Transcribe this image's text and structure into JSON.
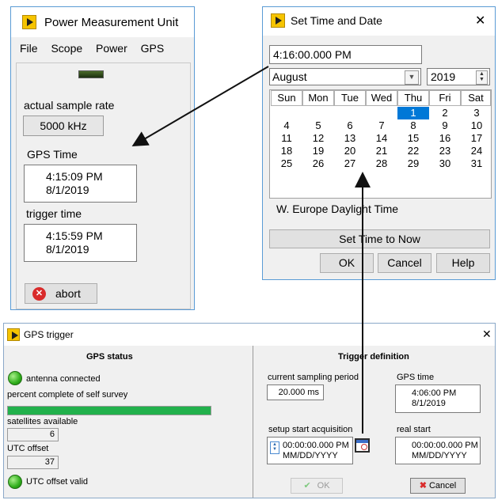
{
  "pmu": {
    "title": "Power Measurement Unit",
    "menu": [
      "File",
      "Scope",
      "Power",
      "GPS"
    ],
    "actual_sample_rate_label": "actual sample rate",
    "actual_sample_rate_value": "5000 kHz",
    "gps_time_label": "GPS Time",
    "gps_time_value": "4:15:09 PM",
    "gps_date_value": "8/1/2019",
    "trigger_time_label": "trigger time",
    "trigger_time_value": "4:15:59 PM",
    "trigger_date_value": "8/1/2019",
    "abort_label": "abort"
  },
  "set_time": {
    "title": "Set Time and Date",
    "close_glyph": "✕",
    "time_input_value": "4:16:00.000 PM",
    "month_value": "August",
    "year_value": "2019",
    "weekdays": [
      "Sun",
      "Mon",
      "Tue",
      "Wed",
      "Thu",
      "Fri",
      "Sat"
    ],
    "days": [
      "",
      "",
      "",
      "",
      "1",
      "2",
      "3",
      "4",
      "5",
      "6",
      "7",
      "8",
      "9",
      "10",
      "11",
      "12",
      "13",
      "14",
      "15",
      "16",
      "17",
      "18",
      "19",
      "20",
      "21",
      "22",
      "23",
      "24",
      "25",
      "26",
      "27",
      "28",
      "29",
      "30",
      "31"
    ],
    "selected_day": "1",
    "timezone": "W. Europe Daylight Time",
    "set_time_to_now_label": "Set Time to Now",
    "ok_label": "OK",
    "cancel_label": "Cancel",
    "help_label": "Help"
  },
  "gps_trigger": {
    "title": "GPS trigger",
    "close_glyph": "✕",
    "gps_status_heading": "GPS status",
    "antenna_connected_label": "antenna connected",
    "survey_label": "percent complete of self survey",
    "survey_progress": 1.0,
    "satellites_label": "satellites available",
    "satellites_value": "6",
    "utc_offset_label": "UTC offset",
    "utc_offset_value": "37",
    "utc_offset_valid_label": "UTC offset valid",
    "trigger_definition_heading": "Trigger definition",
    "current_sampling_period_label": "current sampling period",
    "current_sampling_period_value": "20.000 ms",
    "gps_time_label": "GPS time",
    "gps_time_value": "4:06:00 PM",
    "gps_date_value": "8/1/2019",
    "setup_start_label": "setup start acquisition",
    "setup_start_time": "00:00:00.000 PM",
    "setup_start_date": "MM/DD/YYYY",
    "real_start_label": "real start",
    "real_start_time": "00:00:00.000 PM",
    "real_start_date": "MM/DD/YYYY",
    "ok_label": "OK",
    "cancel_label": "Cancel"
  },
  "colors": {
    "window_border": "#5a9bd5",
    "led_green": "#2fae1b",
    "progress_green": "#22b14c",
    "calendar_selection": "#0078d7",
    "cancel_icon_red": "#d92b2b"
  }
}
